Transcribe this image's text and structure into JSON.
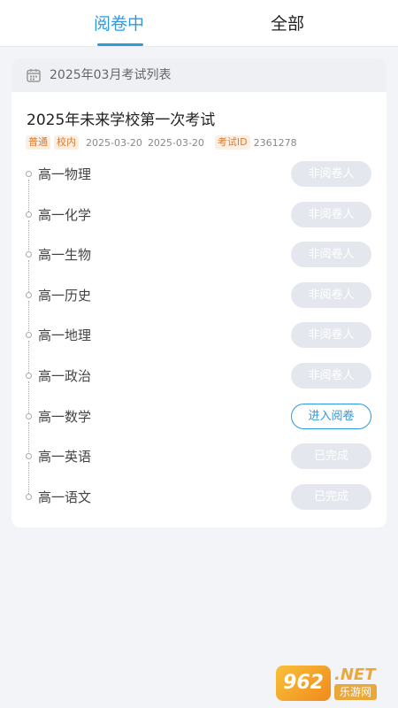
{
  "tabs": [
    {
      "label": "阅卷中",
      "active": true
    },
    {
      "label": "全部",
      "active": false
    }
  ],
  "list_header": {
    "icon": "calendar-icon",
    "period": "2025年03月考试列表"
  },
  "exam": {
    "title": "2025年未来学校第一次考试",
    "tags": [
      "普通",
      "校内"
    ],
    "start_date": "2025-03-20",
    "end_date": "2025-03-20",
    "id_label": "考试ID",
    "id_value": "2361278"
  },
  "subjects": [
    {
      "name": "高一物理",
      "action": "非阅卷人",
      "state": "disabled"
    },
    {
      "name": "高一化学",
      "action": "非阅卷人",
      "state": "disabled"
    },
    {
      "name": "高一生物",
      "action": "非阅卷人",
      "state": "disabled"
    },
    {
      "name": "高一历史",
      "action": "非阅卷人",
      "state": "disabled"
    },
    {
      "name": "高一地理",
      "action": "非阅卷人",
      "state": "disabled"
    },
    {
      "name": "高一政治",
      "action": "非阅卷人",
      "state": "disabled"
    },
    {
      "name": "高一数学",
      "action": "进入阅卷",
      "state": "active"
    },
    {
      "name": "高一英语",
      "action": "已完成",
      "state": "disabled"
    },
    {
      "name": "高一语文",
      "action": "已完成",
      "state": "disabled"
    }
  ],
  "watermark": {
    "logo": "962",
    "net": ".NET",
    "name": "乐游网"
  },
  "colors": {
    "accent": "#2d9ae0",
    "tag_bg": "#fbeee2",
    "tag_text": "#e07a2e",
    "disabled_btn": "#e4e8ee"
  }
}
